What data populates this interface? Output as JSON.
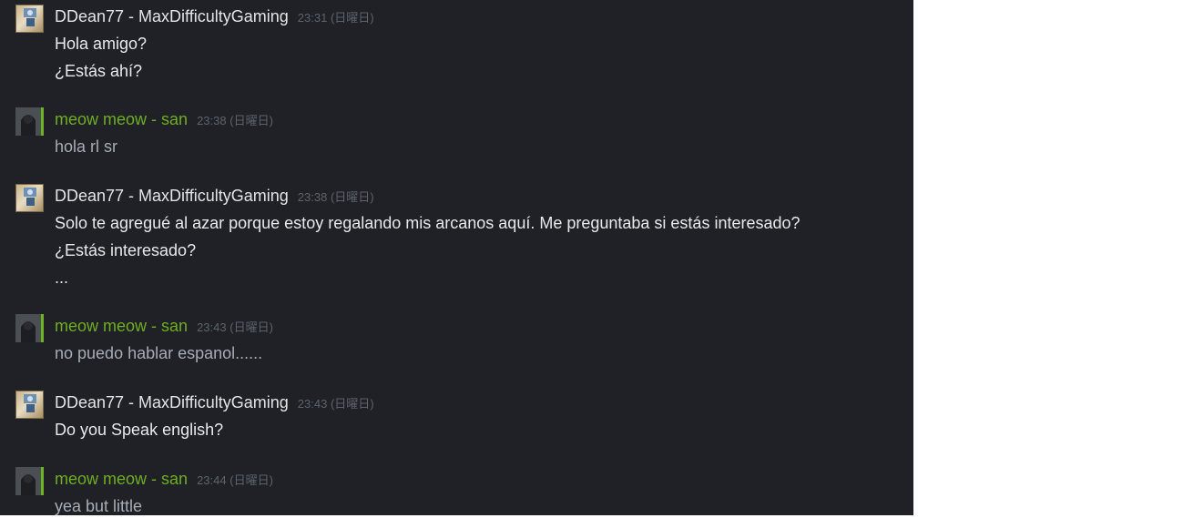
{
  "messages": [
    {
      "sender": "DDean77 - MaxDifficultyGaming",
      "time": "23:31",
      "day": "(日曜日)",
      "role": "friend",
      "lines": [
        "Hola amigo?",
        "¿Estás ahí?"
      ]
    },
    {
      "sender": "meow meow - san",
      "time": "23:38",
      "day": "(日曜日)",
      "role": "me",
      "lines": [
        "hola rl sr"
      ]
    },
    {
      "sender": "DDean77 - MaxDifficultyGaming",
      "time": "23:38",
      "day": "(日曜日)",
      "role": "friend",
      "lines": [
        "Solo te agregué al azar porque estoy regalando mis arcanos aquí. Me preguntaba si estás interesado?",
        "¿Estás interesado?",
        "..."
      ]
    },
    {
      "sender": "meow meow - san",
      "time": "23:43",
      "day": "(日曜日)",
      "role": "me",
      "lines": [
        "no puedo hablar espanol......"
      ]
    },
    {
      "sender": "DDean77 - MaxDifficultyGaming",
      "time": "23:43",
      "day": "(日曜日)",
      "role": "friend",
      "lines": [
        "Do you Speak english?"
      ]
    },
    {
      "sender": "meow meow - san",
      "time": "23:44",
      "day": "(日曜日)",
      "role": "me",
      "lines": [
        "yea but little"
      ]
    }
  ]
}
